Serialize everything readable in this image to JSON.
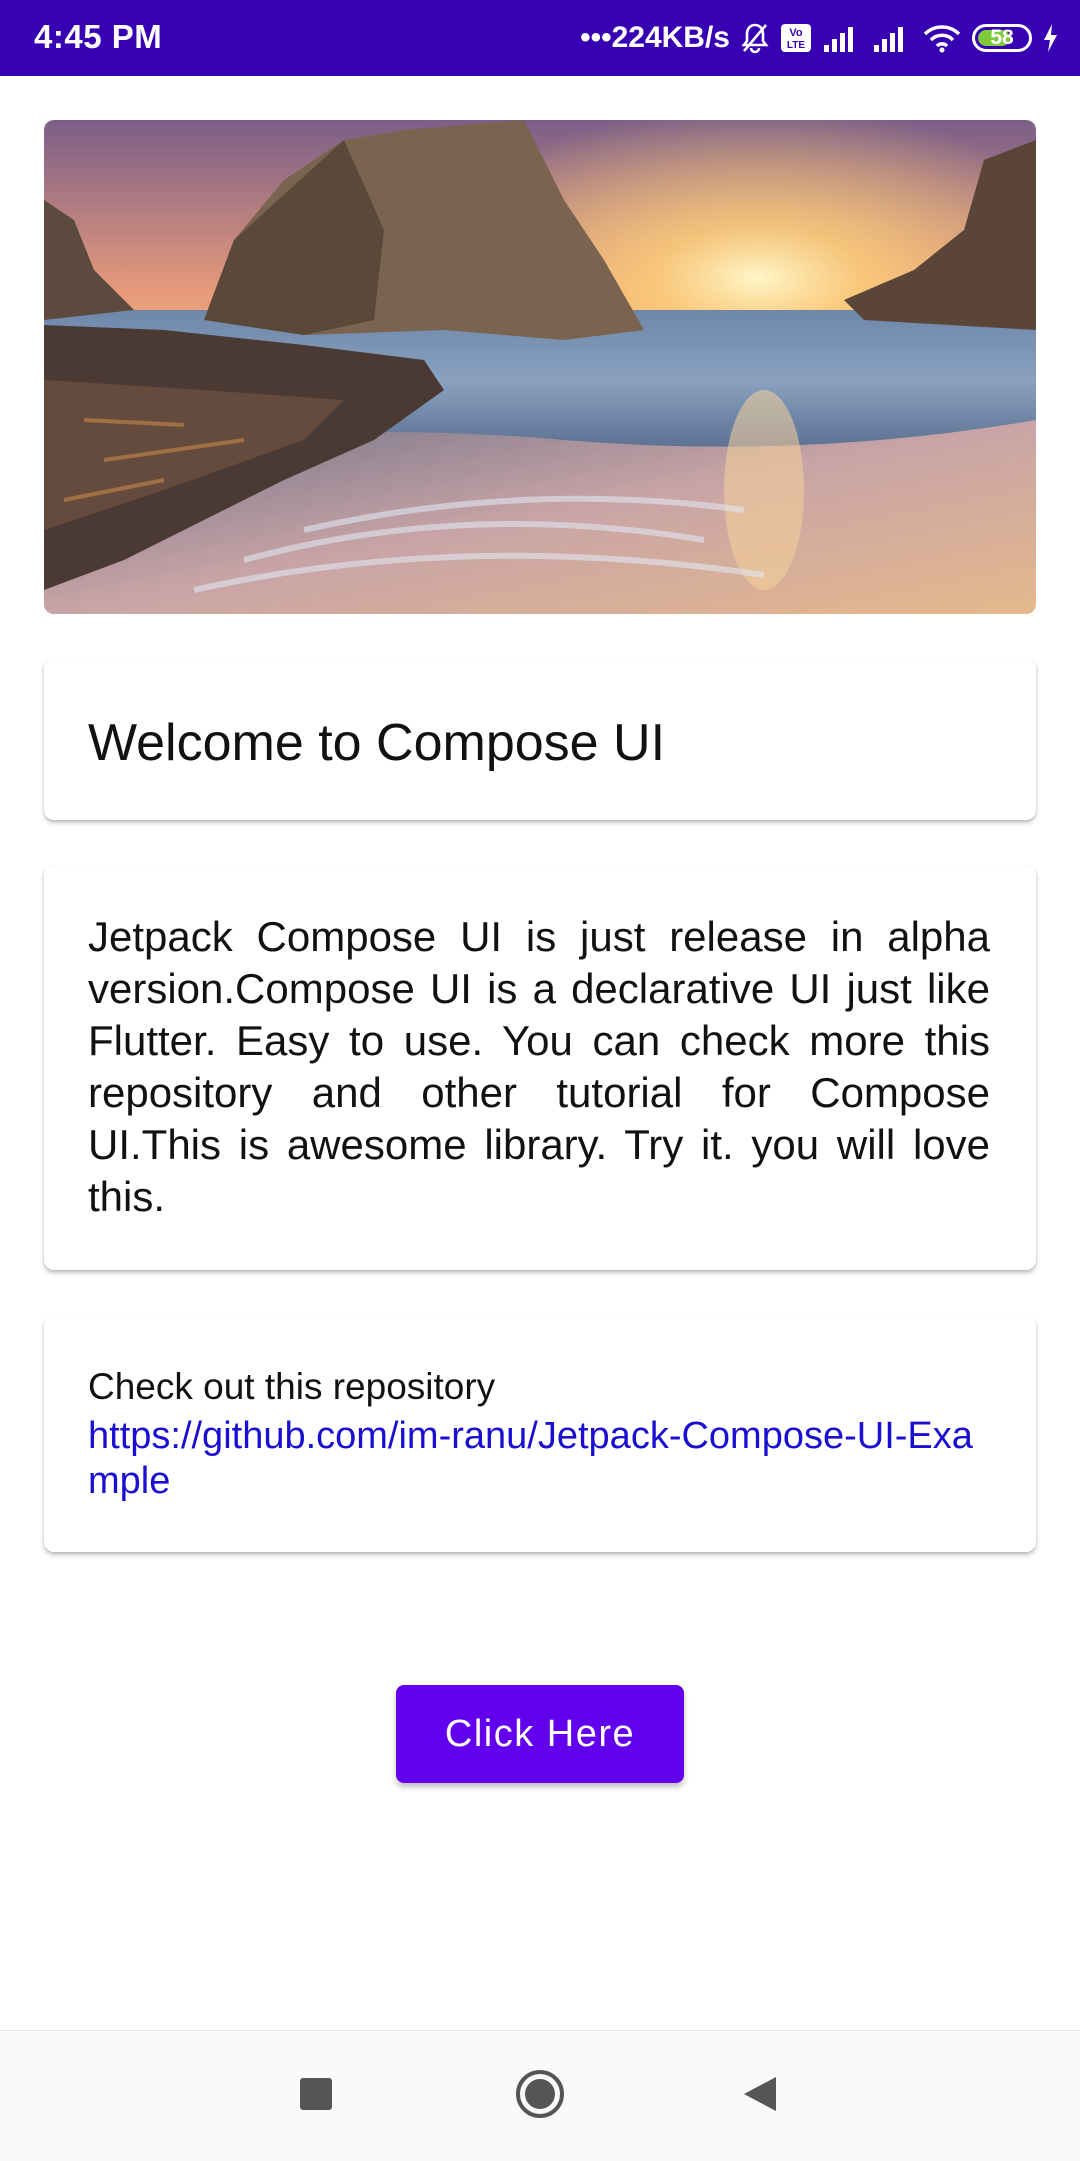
{
  "status_bar": {
    "time": "4:45 PM",
    "network_speed": "•••224KB/s",
    "battery_level": "58",
    "icons": [
      "mute-bell-icon",
      "volte-icon",
      "signal-icon",
      "signal-icon",
      "wifi-icon",
      "battery-icon",
      "charging-icon"
    ]
  },
  "hero_image": {
    "subject": "sunset over rocky beach"
  },
  "title_card": {
    "text": "Welcome to Compose UI"
  },
  "description_card": {
    "text": "Jetpack Compose UI is just release in alpha version.Compose UI is a declarative UI just like Flutter. Easy to use. You can check more this repository and other tutorial for Compose UI.This is awesome library. Try it. you will love this."
  },
  "repo_card": {
    "label": "Check out this repository",
    "link": "https://github.com/im-ranu/Jetpack-Compose-UI-Example"
  },
  "button": {
    "label": "Click Here"
  },
  "nav_bar": {
    "buttons": [
      "recents-icon",
      "home-icon",
      "back-icon"
    ]
  },
  "colors": {
    "status_bar": "#3700b3",
    "button": "#6200ee",
    "link": "#1a0fd1"
  }
}
